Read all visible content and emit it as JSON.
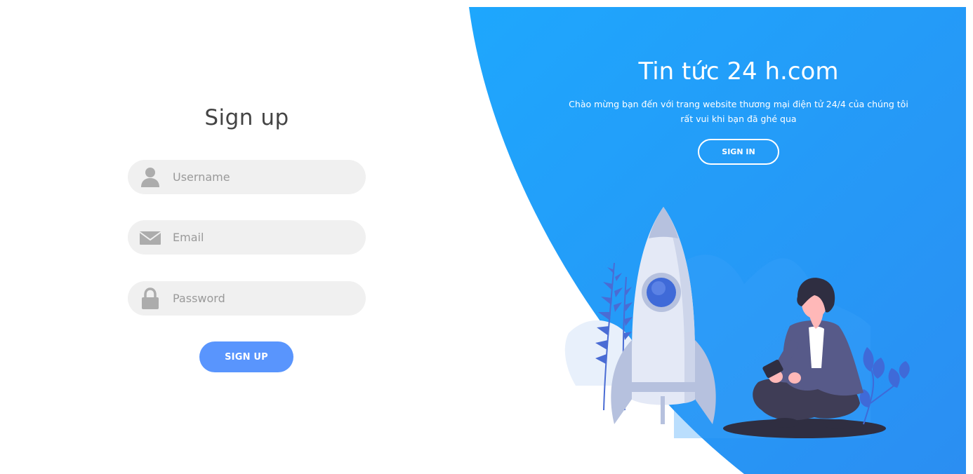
{
  "signup": {
    "title": "Sign up",
    "username_placeholder": "Username",
    "email_placeholder": "Email",
    "password_placeholder": "Password",
    "submit_label": "SIGN UP",
    "icons": {
      "username": "user-icon",
      "email": "envelope-icon",
      "password": "lock-icon"
    }
  },
  "panel": {
    "title": "Tin tức 24 h.com",
    "description": "Chào mừng bạn đến với trang website thương mại điện tử 24/4 của chúng tôi rất vui khi bạn đã ghé qua",
    "signin_label": "SIGN IN"
  },
  "colors": {
    "accent": "#5995fd",
    "panel_gradient_start": "#1ea7fd",
    "panel_gradient_end": "#2d8ff2",
    "field_bg": "#f0f0f0",
    "icon_gray": "#acacac"
  }
}
